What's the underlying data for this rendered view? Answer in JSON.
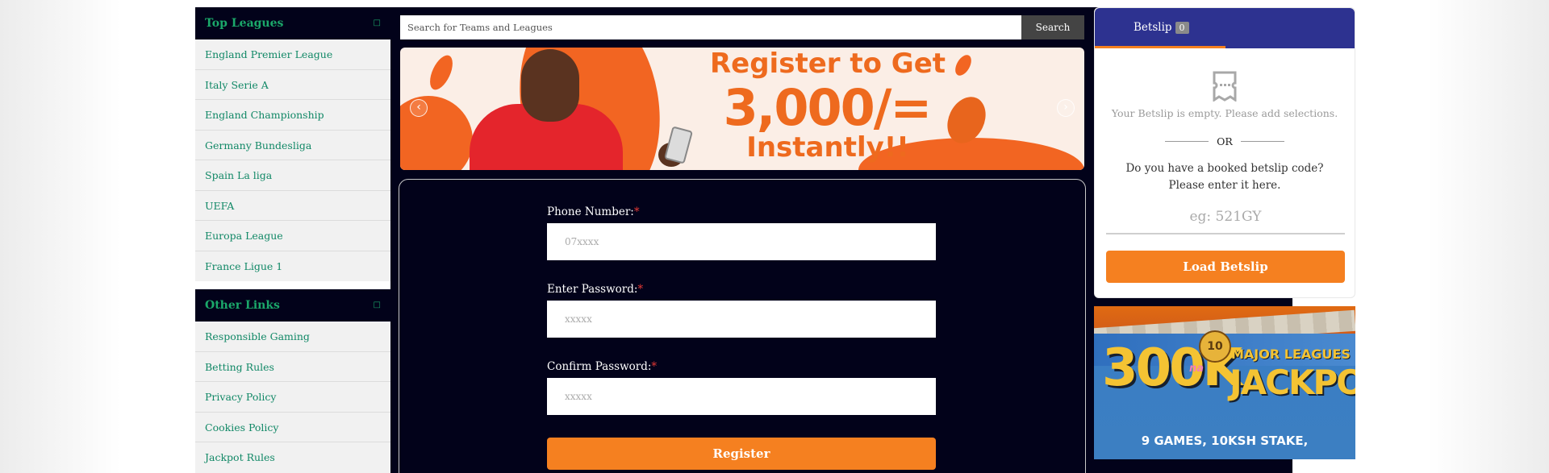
{
  "sidebar": {
    "top_leagues_title": "Top Leagues",
    "toggle_icon": "collapse-icon",
    "top_leagues": [
      "England Premier League",
      "Italy Serie A",
      "England Championship",
      "Germany Bundesliga",
      "Spain La liga",
      "UEFA",
      "Europa League",
      "France Ligue 1"
    ],
    "other_links_title": "Other Links",
    "other_links": [
      "Responsible Gaming",
      "Betting Rules",
      "Privacy Policy",
      "Cookies Policy",
      "Jackpot Rules"
    ]
  },
  "search": {
    "placeholder": "Search for Teams and Leagues",
    "button_label": "Search"
  },
  "banner": {
    "line1": "Register to Get",
    "line2": "3,000/=",
    "line3": "Instantly!!",
    "prev_icon": "chevron-left-icon",
    "next_icon": "chevron-right-icon",
    "prev_glyph": "‹",
    "next_glyph": "›"
  },
  "register_form": {
    "phone_label": "Phone Number:",
    "phone_placeholder": "07xxxx",
    "password_label": "Enter Password:",
    "password_placeholder": "xxxxx",
    "confirm_label": "Confirm Password:",
    "confirm_placeholder": "xxxxx",
    "required_mark": "*",
    "register_button": "Register"
  },
  "betslip": {
    "tab_label": "Betslip",
    "count": "0",
    "empty_message": "Your Betslip is empty. Please add selections.",
    "or_text": "OR",
    "booked_code_prompt": "Do you have a booked betslip code? Please enter it here.",
    "code_placeholder": "eg: 521GY",
    "load_button": "Load Betslip"
  },
  "jackpot_banner": {
    "big_text": "300K",
    "na_text": "na",
    "badge_text": "10",
    "major_text": "MAJOR LEAGUES",
    "jackpot_text": "JACKPOT!",
    "bottom_text": "9 GAMES, 10KSH STAKE,"
  },
  "colors": {
    "dark_navy": "#02021a",
    "league_green": "#1ba86a",
    "accent_orange": "#f58020",
    "betslip_blue": "#2d3290"
  }
}
